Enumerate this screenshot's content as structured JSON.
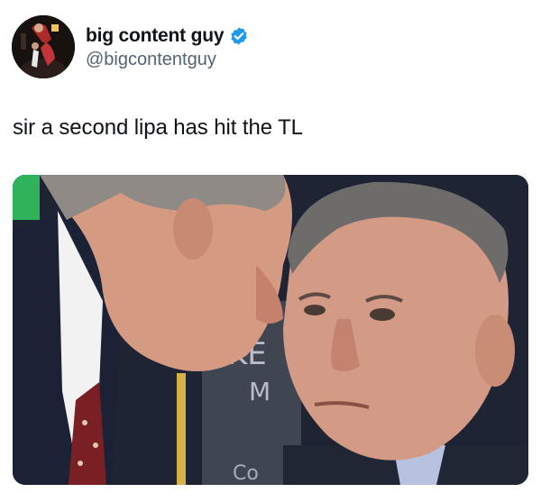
{
  "author": {
    "display_name": "big content guy",
    "handle": "@bigcontentguy",
    "verified": true,
    "avatar_icon": "avatar-photo-icon"
  },
  "tweet": {
    "text": "sir a second lipa has hit the TL"
  },
  "media": {
    "icon": "photo-icon",
    "board_text_1": "KE",
    "board_text_2": "M",
    "board_text_3": "Co"
  },
  "colors": {
    "verified_blue": "#1d9bf0",
    "text_primary": "#0f1419",
    "text_secondary": "#536471"
  }
}
